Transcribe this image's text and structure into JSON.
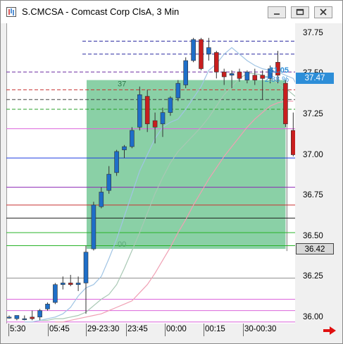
{
  "window": {
    "title": "S.CMCSA - Comcast Corp ClsA, 3 Min",
    "minimize_glyph": "—",
    "maximize_glyph": "▢",
    "close_glyph": "✕",
    "icons": [
      "app-icon",
      "minimize-icon",
      "maximize-icon",
      "close-icon",
      "red-arrow-right-icon"
    ]
  },
  "chart": {
    "y_ticks": [
      "37.75",
      "37.50",
      "37.25",
      "37.00",
      "36.75",
      "36.50",
      "36.25",
      "36.00"
    ],
    "last_price_label": "37.47",
    "last_price": 37.47,
    "crosshair_price_label": "36.42",
    "crosshair_price": 36.42,
    "x_ticks": [
      "5:30",
      "05:45",
      "29-23:30",
      "23:45",
      "00:00",
      "00:15",
      "30-00:30"
    ],
    "box_top_label": "37",
    "box_bottom_label": "00",
    "change_value": "$1.05",
    "change_percent": "2.88 %",
    "colors": {
      "up_candle": "#1e6ec8",
      "down_candle": "#c81e1e",
      "box_fill": "#76c896",
      "last_price_tag": "#2d8ed8",
      "change_text": "#2d8ed8"
    }
  },
  "chart_data": {
    "type": "candlestick",
    "y_range": [
      35.96,
      37.81
    ],
    "candles": [
      {
        "o": 36.0,
        "h": 36.01,
        "l": 35.99,
        "c": 36.0
      },
      {
        "o": 35.99,
        "h": 36.01,
        "l": 35.98,
        "c": 36.01
      },
      {
        "o": 35.99,
        "h": 36.01,
        "l": 35.98,
        "c": 35.99
      },
      {
        "o": 36.0,
        "h": 36.04,
        "l": 35.98,
        "c": 35.99
      },
      {
        "o": 36.0,
        "h": 36.05,
        "l": 35.98,
        "c": 36.04
      },
      {
        "o": 36.05,
        "h": 36.09,
        "l": 36.04,
        "c": 36.08
      },
      {
        "o": 36.09,
        "h": 36.21,
        "l": 36.08,
        "c": 36.2
      },
      {
        "o": 36.2,
        "h": 36.25,
        "l": 36.17,
        "c": 36.21
      },
      {
        "o": 36.21,
        "h": 36.26,
        "l": 36.19,
        "c": 36.2
      },
      {
        "o": 36.2,
        "h": 36.25,
        "l": 36.16,
        "c": 36.21
      },
      {
        "o": 36.21,
        "h": 36.44,
        "l": 36.02,
        "c": 36.4
      },
      {
        "o": 36.42,
        "h": 36.71,
        "l": 36.41,
        "c": 36.69
      },
      {
        "o": 36.68,
        "h": 36.8,
        "l": 36.67,
        "c": 36.77
      },
      {
        "o": 36.78,
        "h": 36.93,
        "l": 36.76,
        "c": 36.88
      },
      {
        "o": 36.89,
        "h": 37.03,
        "l": 36.87,
        "c": 37.02
      },
      {
        "o": 37.03,
        "h": 37.06,
        "l": 36.98,
        "c": 37.05
      },
      {
        "o": 37.05,
        "h": 37.17,
        "l": 37.04,
        "c": 37.15
      },
      {
        "o": 37.17,
        "h": 37.42,
        "l": 37.15,
        "c": 37.37
      },
      {
        "o": 37.36,
        "h": 37.4,
        "l": 37.14,
        "c": 37.19
      },
      {
        "o": 37.21,
        "h": 37.26,
        "l": 37.07,
        "c": 37.17
      },
      {
        "o": 37.19,
        "h": 37.29,
        "l": 37.11,
        "c": 37.26
      },
      {
        "o": 37.26,
        "h": 37.36,
        "l": 37.24,
        "c": 37.35
      },
      {
        "o": 37.35,
        "h": 37.46,
        "l": 37.33,
        "c": 37.44
      },
      {
        "o": 37.43,
        "h": 37.6,
        "l": 37.41,
        "c": 37.58
      },
      {
        "o": 37.58,
        "h": 37.72,
        "l": 37.57,
        "c": 37.71
      },
      {
        "o": 37.71,
        "h": 37.72,
        "l": 37.52,
        "c": 37.53
      },
      {
        "o": 37.62,
        "h": 37.72,
        "l": 37.58,
        "c": 37.66
      },
      {
        "o": 37.63,
        "h": 37.64,
        "l": 37.47,
        "c": 37.51
      },
      {
        "o": 37.51,
        "h": 37.53,
        "l": 37.43,
        "c": 37.48
      },
      {
        "o": 37.49,
        "h": 37.52,
        "l": 37.41,
        "c": 37.5
      },
      {
        "o": 37.51,
        "h": 37.53,
        "l": 37.45,
        "c": 37.47
      },
      {
        "o": 37.46,
        "h": 37.52,
        "l": 37.44,
        "c": 37.51
      },
      {
        "o": 37.49,
        "h": 37.53,
        "l": 37.43,
        "c": 37.46
      },
      {
        "o": 37.49,
        "h": 37.52,
        "l": 37.34,
        "c": 37.47
      },
      {
        "o": 37.47,
        "h": 37.55,
        "l": 37.44,
        "c": 37.53
      },
      {
        "o": 37.57,
        "h": 37.64,
        "l": 37.44,
        "c": 37.49
      },
      {
        "o": 37.44,
        "h": 37.46,
        "l": 37.17,
        "c": 37.19
      },
      {
        "o": 37.15,
        "h": 37.26,
        "l": 36.99,
        "c": 37.0
      }
    ],
    "ma_fast": [
      35.97,
      35.97,
      35.98,
      35.99,
      36.0,
      36.02,
      36.06,
      36.13,
      36.18,
      36.2,
      36.25,
      36.36,
      36.48,
      36.62,
      36.76,
      36.9,
      37.0,
      37.1,
      37.17,
      37.2,
      37.22,
      37.28,
      37.35,
      37.42,
      37.52,
      37.56,
      37.62,
      37.66,
      37.62,
      37.58,
      37.55,
      37.53,
      37.52,
      37.51,
      37.49,
      37.47,
      37.38
    ],
    "ma_mid": [
      35.98,
      35.98,
      35.99,
      35.99,
      36.0,
      36.01,
      36.03,
      36.07,
      36.11,
      36.14,
      36.2,
      36.3,
      36.41,
      36.52,
      36.64,
      36.76,
      36.86,
      36.95,
      37.02,
      37.07,
      37.12,
      37.17,
      37.23,
      37.3,
      37.37,
      37.42,
      37.47,
      37.5,
      37.5,
      37.49,
      37.47,
      37.44,
      37.41,
      37.37,
      37.33
    ],
    "ma_slow": [
      35.97,
      35.97,
      35.98,
      35.99,
      36.0,
      36.01,
      36.02,
      36.04,
      36.06,
      36.08,
      36.1,
      36.15,
      36.2,
      36.27,
      36.35,
      36.43,
      36.52,
      36.6,
      36.69,
      36.77,
      36.85,
      36.92,
      36.99,
      37.05,
      37.11,
      37.17,
      37.22,
      37.26,
      37.3,
      37.32,
      37.33,
      37.33
    ],
    "levels": [
      {
        "p": 37.7,
        "color": "#2a2aa0",
        "dash": true
      },
      {
        "p": 37.62,
        "color": "#2a2aa0",
        "dash": true
      },
      {
        "p": 37.51,
        "color": "#6a2aa0",
        "dash": true
      },
      {
        "p": 37.4,
        "color": "#c83232",
        "dash": true
      },
      {
        "p": 37.34,
        "color": "#404040",
        "dash": true
      },
      {
        "p": 37.28,
        "color": "#28a028",
        "dash": true
      },
      {
        "p": 37.16,
        "color": "#dc64dc",
        "dash": false
      },
      {
        "p": 36.98,
        "color": "#1e3ce0",
        "dash": false
      },
      {
        "p": 36.8,
        "color": "#8c28b4",
        "dash": false
      },
      {
        "p": 36.69,
        "color": "#c83232",
        "dash": false
      },
      {
        "p": 36.61,
        "color": "#202020",
        "dash": false
      },
      {
        "p": 36.52,
        "color": "#28b428",
        "dash": false
      },
      {
        "p": 36.44,
        "color": "#28b428",
        "dash": false
      },
      {
        "p": 36.24,
        "color": "#909090",
        "dash": false
      },
      {
        "p": 36.11,
        "color": "#dc64dc",
        "dash": false
      },
      {
        "p": 36.04,
        "color": "#dc64dc",
        "dash": false
      },
      {
        "p": 35.97,
        "color": "#dc64dc",
        "dash": false
      }
    ],
    "box": {
      "from_index": 10,
      "to_index": 36,
      "top": 37.46,
      "bottom": 36.42
    }
  }
}
